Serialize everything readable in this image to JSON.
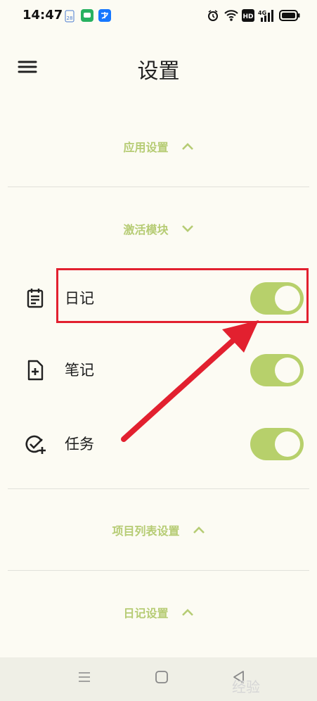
{
  "status_bar": {
    "time": "14:47",
    "calendar_date": "28",
    "hd_label": "HD",
    "network_label": "4G"
  },
  "header": {
    "title": "设置"
  },
  "sections": {
    "app_settings": "应用设置",
    "activate_modules": "激活模块",
    "project_list_settings": "项目列表设置",
    "diary_settings": "日记设置"
  },
  "modules": [
    {
      "label": "日记",
      "icon": "diary-icon",
      "enabled": true
    },
    {
      "label": "笔记",
      "icon": "note-add-icon",
      "enabled": true
    },
    {
      "label": "任务",
      "icon": "task-add-icon",
      "enabled": true
    }
  ],
  "accent_color": "#b7d06b",
  "annotation_color": "#e2202f",
  "watermark": "经验"
}
